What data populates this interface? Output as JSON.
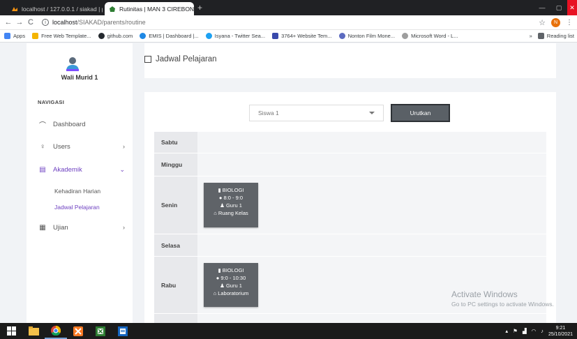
{
  "browser": {
    "tabs": [
      {
        "title": "localhost / 127.0.0.1 / siakad | ph",
        "active": false
      },
      {
        "title": "Rutinitas | MAN 3 CIREBON",
        "active": true
      }
    ],
    "url_host": "localhost",
    "url_path": "/SIAKAD/parents/routine",
    "profile_initial": "N",
    "bookmarks": [
      "Apps",
      "Free Web Template...",
      "github.com",
      "EMIS | Dashboard |...",
      "Isyana - Twitter Sea...",
      "3764+ Website Tem...",
      "Nonton Film Mone...",
      "Microsoft Word - L..."
    ],
    "more_bookmarks": "»",
    "reading_list": "Reading list"
  },
  "sidebar": {
    "user_name": "Wali Murid 1",
    "nav_label": "NAVIGASI",
    "items": {
      "dashboard": "Dashboard",
      "users": "Users",
      "akademik": "Akademik",
      "ujian": "Ujian"
    },
    "sub_items": {
      "kehadiran": "Kehadiran Harian",
      "jadwal": "Jadwal Pelajaran"
    }
  },
  "header": {
    "title": "Jadwal Pelajaran"
  },
  "filter": {
    "selected": "Siswa 1",
    "button": "Urutkan"
  },
  "schedule": {
    "sabtu": "Sabtu",
    "minggu": "Minggu",
    "senin": "Senin",
    "selasa": "Selasa",
    "rabu": "Rabu",
    "senin_class": {
      "subject": "BIOLOGI",
      "time": "8:0 - 9:0",
      "teacher": "Guru 1",
      "room": "Ruang Kelas"
    },
    "rabu_class": {
      "subject": "BIOLOGI",
      "time": "9:0 - 10:30",
      "teacher": "Guru 1",
      "room": "Laboratorium"
    }
  },
  "watermark": {
    "line1": "Activate Windows",
    "line2": "Go to PC settings to activate Windows."
  },
  "taskbar": {
    "time": "9:21",
    "date": "25/10/2021"
  },
  "colors": {
    "accent": "#6f42c1",
    "button": "#5a6066",
    "chip": "#5f6368"
  }
}
